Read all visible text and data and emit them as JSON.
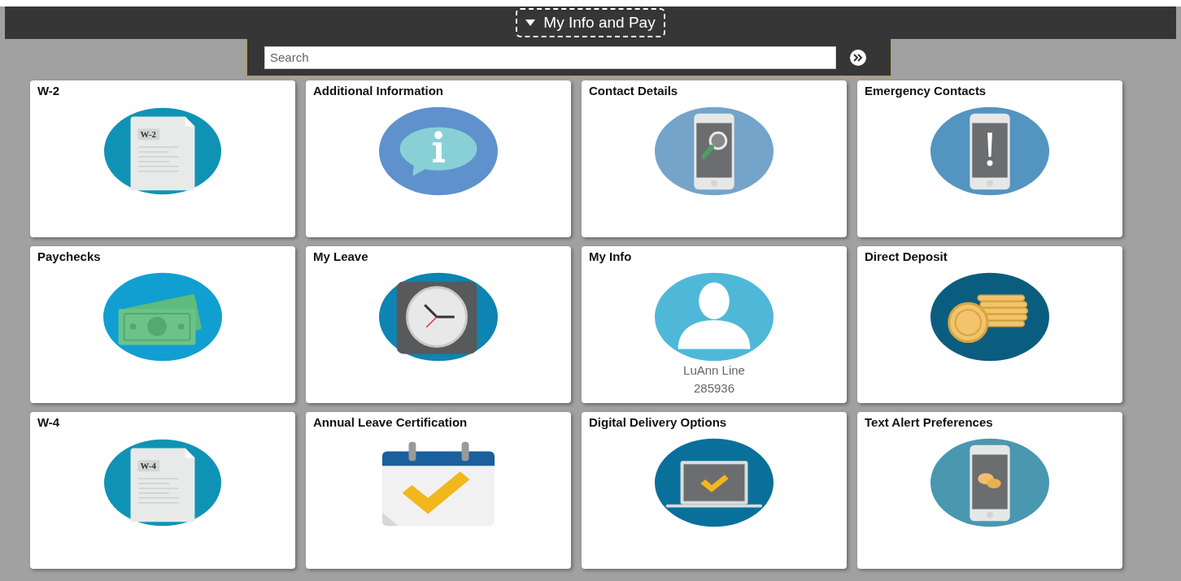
{
  "header": {
    "title": "My Info and Pay"
  },
  "search": {
    "placeholder": "Search"
  },
  "tiles": [
    {
      "title": "W-2",
      "kind": "document",
      "icon_text": "W-2"
    },
    {
      "title": "Additional Information",
      "kind": "info"
    },
    {
      "title": "Contact Details",
      "kind": "phone-search"
    },
    {
      "title": "Emergency Contacts",
      "kind": "phone-alert"
    },
    {
      "title": "Paychecks",
      "kind": "money"
    },
    {
      "title": "My Leave",
      "kind": "clock"
    },
    {
      "title": "My Info",
      "kind": "person",
      "lines": [
        "LuAnn Line",
        "285936"
      ]
    },
    {
      "title": "Direct Deposit",
      "kind": "coins"
    },
    {
      "title": "W-4",
      "kind": "document",
      "icon_text": "W-4"
    },
    {
      "title": "Annual Leave Certification",
      "kind": "calendar"
    },
    {
      "title": "Digital Delivery Options",
      "kind": "laptop"
    },
    {
      "title": "Text Alert Preferences",
      "kind": "phone-chat"
    }
  ]
}
